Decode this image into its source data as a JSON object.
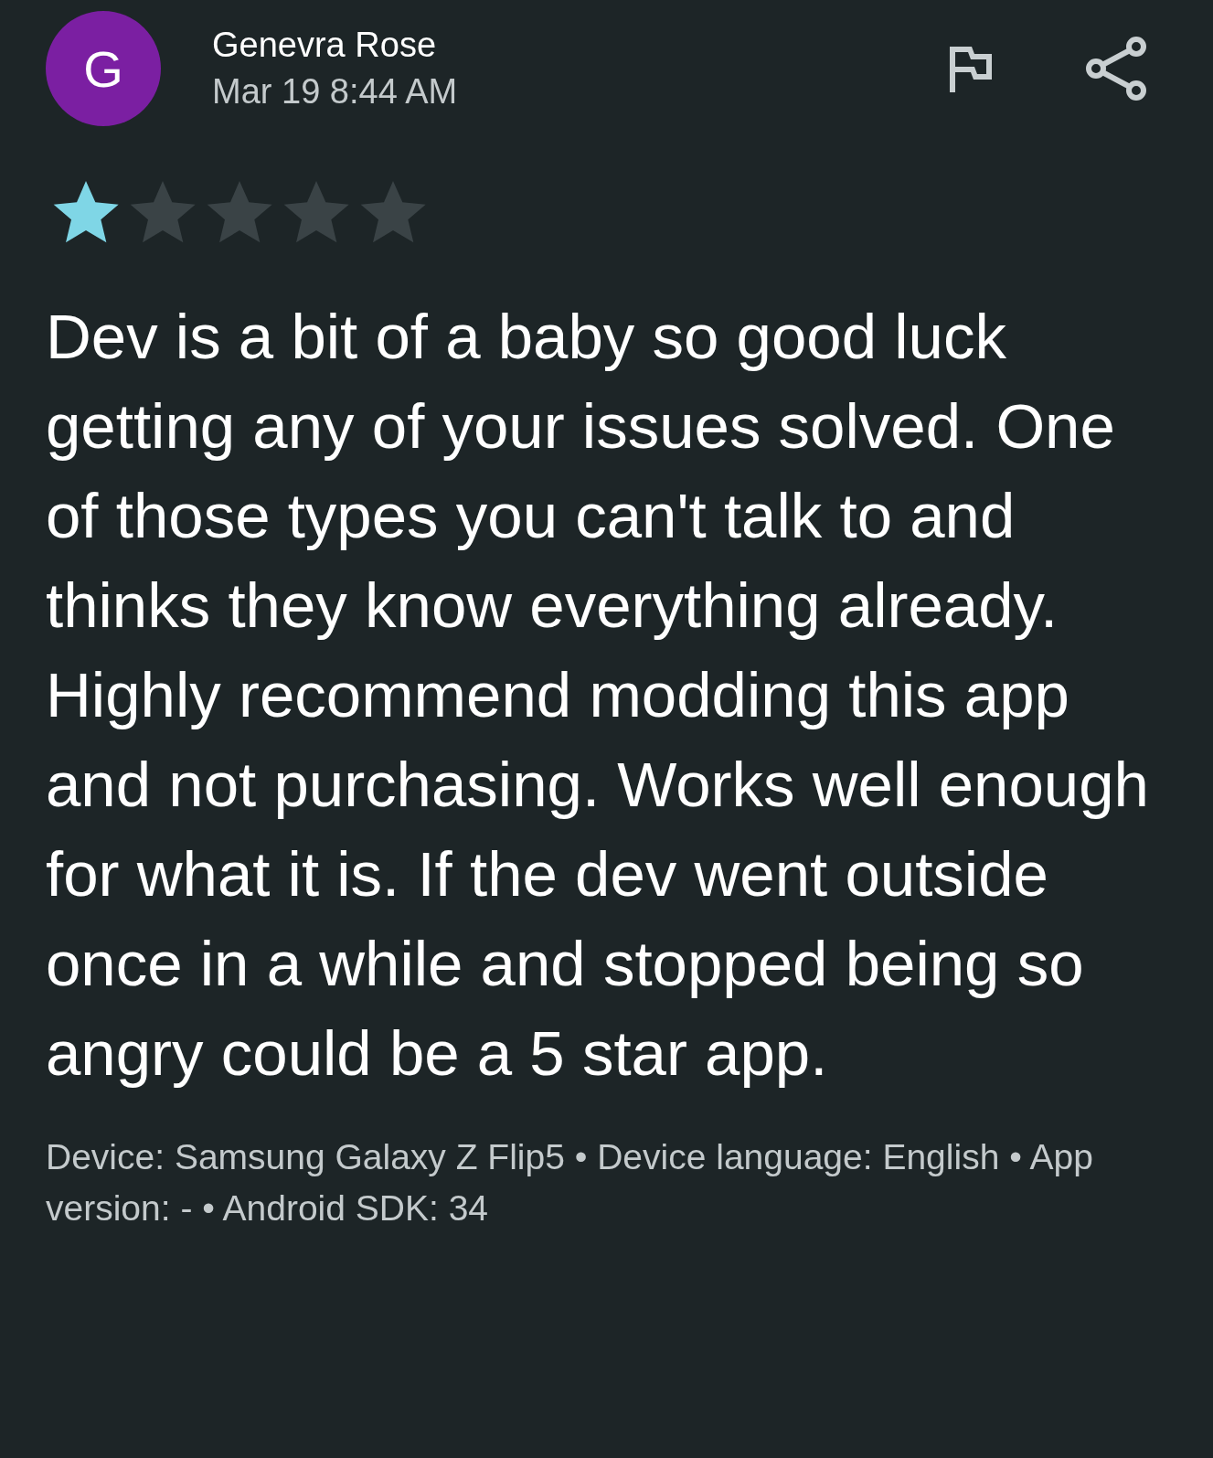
{
  "review": {
    "avatar_letter": "G",
    "author": "Genevra Rose",
    "date": "Mar 19 8:44 AM",
    "stars": 1,
    "text": "Dev is a bit of a baby so good luck getting any of your issues solved. One of those types you can't talk to and thinks they know everything already. Highly recommend modding this app and not purchasing. Works well enough for what it is. If the dev went outside once in a while and stopped being so angry could be a 5 star app.",
    "device_info": "Device: Samsung Galaxy Z Flip5 • Device language: English • App version: - • Android SDK: 34"
  }
}
